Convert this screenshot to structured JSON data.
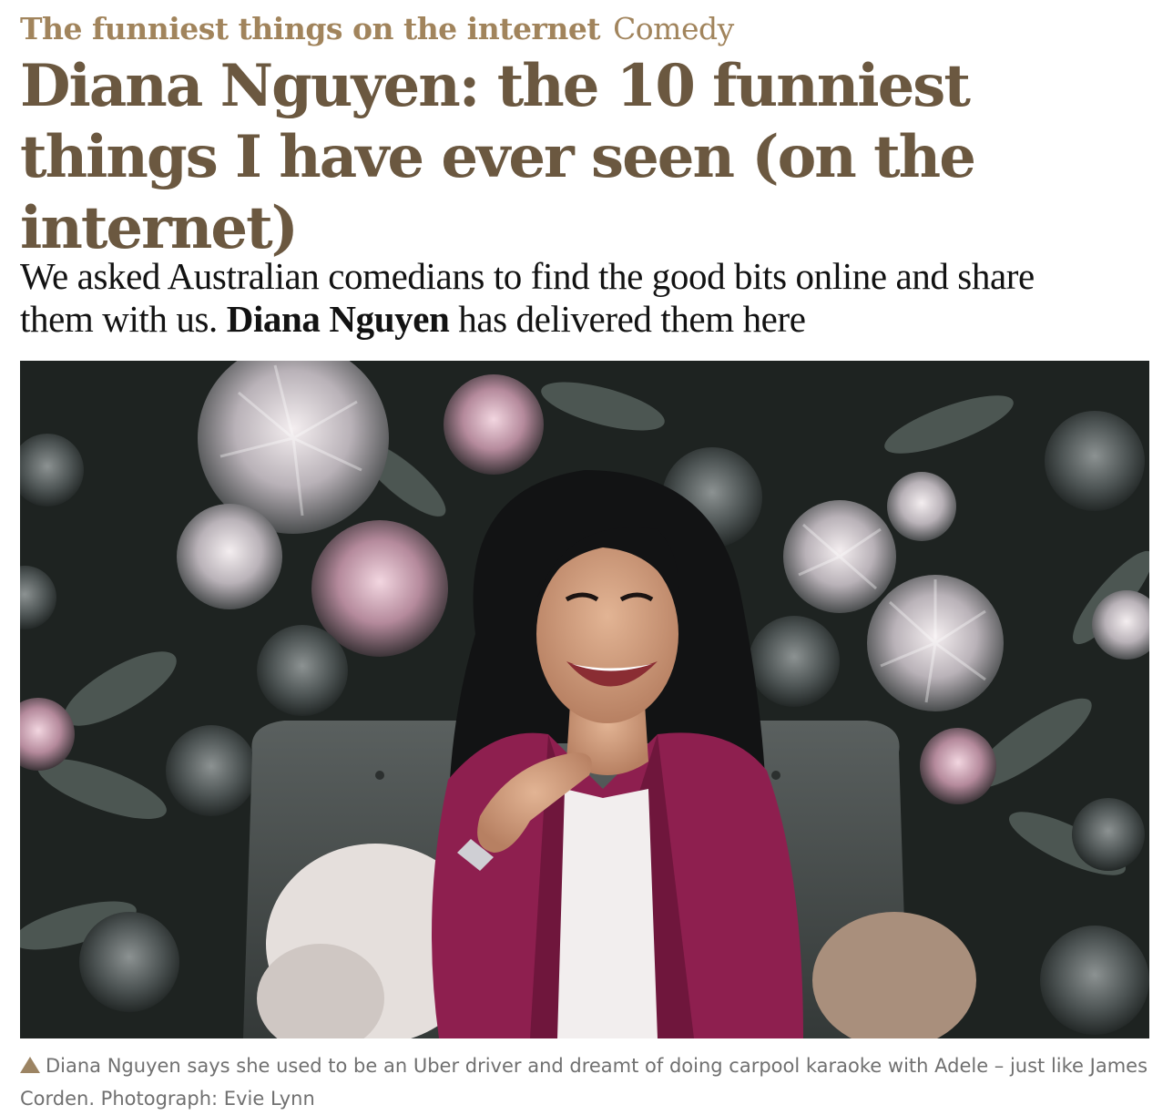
{
  "article": {
    "series": "The funniest things on the internet",
    "section": "Comedy",
    "headline": "Diana Nguyen: the 10 funniest things I have ever seen (on the internet)",
    "standfirst_before": "We asked Australian comedians to find the good bits online and share them with us. ",
    "standfirst_name": "Diana Nguyen",
    "standfirst_after": " has delivered them here",
    "caption": "Diana Nguyen says she used to be an Uber driver and dreamt of doing carpool karaoke with Adele – just like James Corden. Photograph: Evie Lynn",
    "caption_icon": "triangle-up-icon"
  },
  "colors": {
    "kicker": "#a1845c",
    "headline": "#6b5840",
    "body_text": "#121212",
    "caption_text": "#707070",
    "blazer": "#8e1f4f",
    "wallpaper": "#1e2321"
  }
}
